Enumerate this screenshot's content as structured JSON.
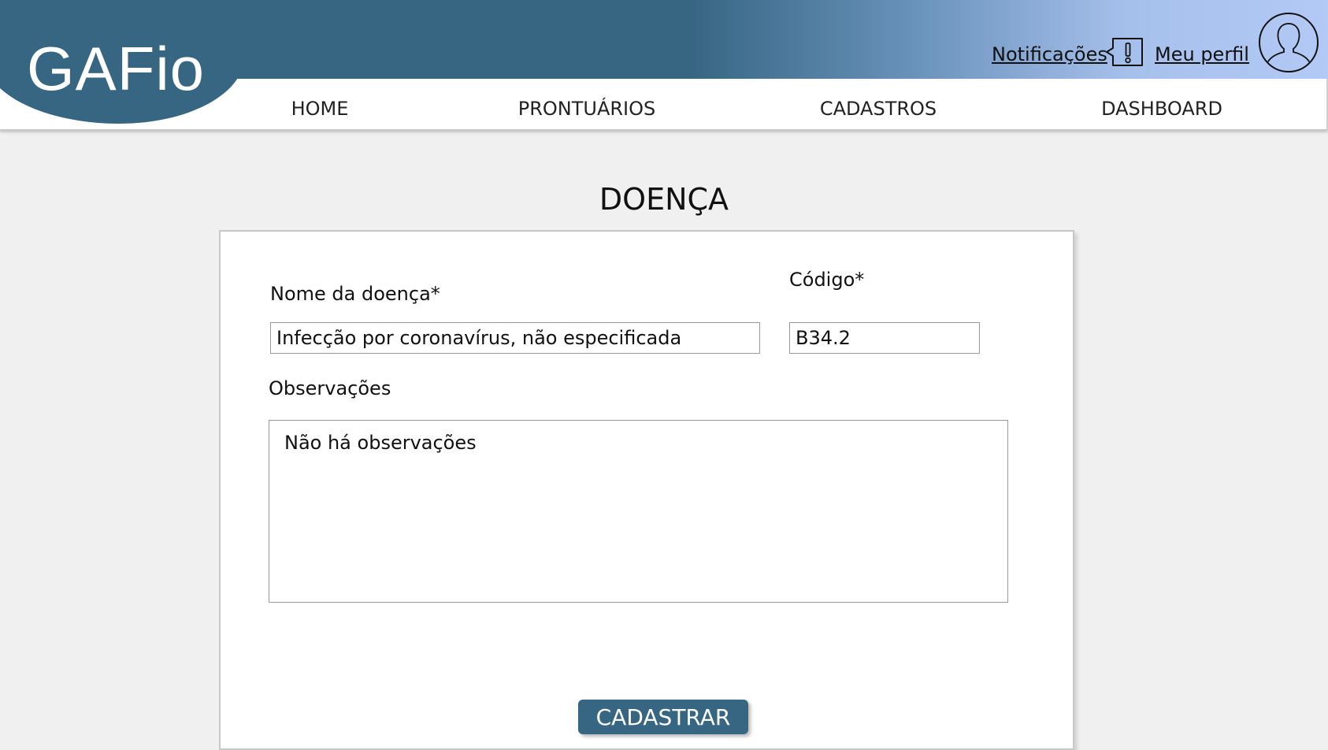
{
  "app": {
    "logo": "GAFio"
  },
  "header": {
    "notifications_label": "Notificações",
    "profile_label": "Meu perfil",
    "notification_icon": "alert-speech-bubble-icon",
    "avatar_icon": "user-silhouette-icon"
  },
  "nav": {
    "items": [
      {
        "label": "HOME"
      },
      {
        "label": "PRONTUÁRIOS"
      },
      {
        "label": "CADASTROS"
      },
      {
        "label": "DASHBOARD"
      }
    ]
  },
  "page": {
    "title": "DOENÇA"
  },
  "form": {
    "name_label": "Nome da doença*",
    "name_value": "Infecção por coronavírus, não especificada",
    "code_label": "Código*",
    "code_value": "B34.2",
    "notes_label": "Observações",
    "notes_value": "Não há observações",
    "submit_label": "CADASTRAR"
  },
  "colors": {
    "primary": "#376683",
    "header_gradient_end": "#b3c9f6",
    "page_background": "#f0f0f0"
  }
}
